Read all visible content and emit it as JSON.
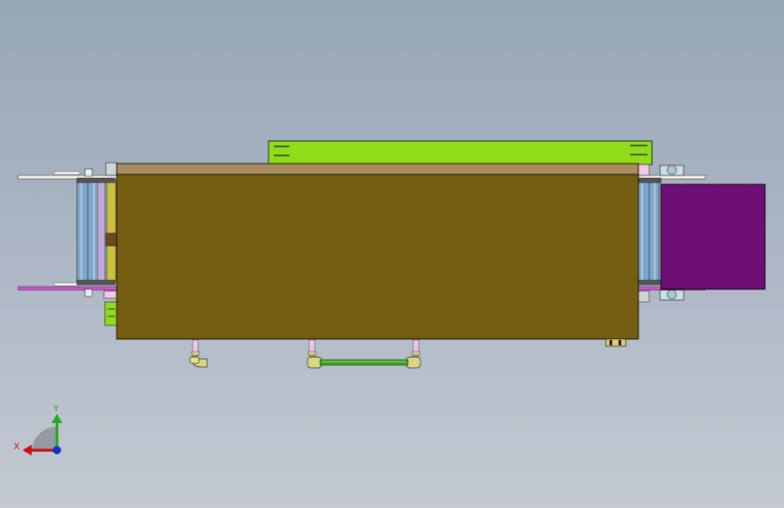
{
  "view": {
    "background_top": "#97a6b7",
    "background_bottom": "#c4c9d3"
  },
  "colors": {
    "main_body": "#755d12",
    "top_plate": "#a88d62",
    "green_panel": "#8fdc1a",
    "purple_motor": "#6e0f78",
    "roller_blue": "#7fa7c9",
    "roller_yellow": "#c9c23a",
    "magenta_rail": "#c43ec9",
    "pipe_green": "#3ea524",
    "fitting_yellow": "#d8d680",
    "pink_stub": "#f0c8e6"
  },
  "triad": {
    "x_label": "X",
    "y_label": "Y",
    "x_color": "#cc1111",
    "y_color": "#22aa22",
    "z_color": "#1133cc"
  }
}
